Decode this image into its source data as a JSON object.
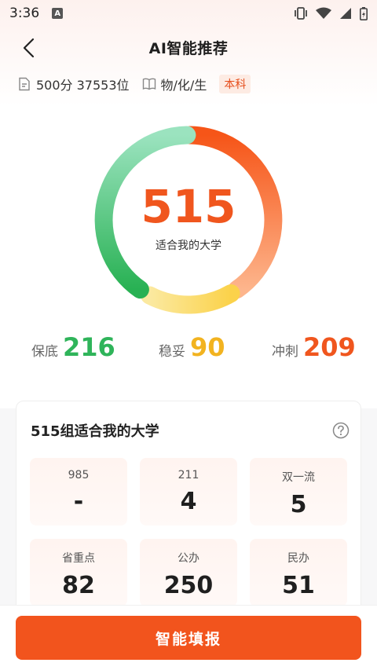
{
  "status_bar": {
    "time": "3:36",
    "app_icon_letter": "A"
  },
  "nav": {
    "title": "AI智能推荐"
  },
  "info": {
    "score_rank": "500分 37553位",
    "subjects": "物/化/生",
    "level": "本科"
  },
  "ring": {
    "total": "515",
    "subtitle": "适合我的大学"
  },
  "stats": [
    {
      "label": "保底",
      "value": "216",
      "color": "#2fb45a"
    },
    {
      "label": "稳妥",
      "value": "90",
      "color": "#f2b320"
    },
    {
      "label": "冲刺",
      "value": "209",
      "color": "#f0561e"
    }
  ],
  "card": {
    "title": "515组适合我的大学",
    "cells": [
      {
        "label": "985",
        "value": "-"
      },
      {
        "label": "211",
        "value": "4"
      },
      {
        "label": "双一流",
        "value": "5"
      },
      {
        "label": "省重点",
        "value": "82"
      },
      {
        "label": "公办",
        "value": "250"
      },
      {
        "label": "民办",
        "value": "51"
      }
    ]
  },
  "submit": {
    "label": "智能填报"
  },
  "colors": {
    "accent": "#f2541d",
    "safe": "#2fb45a",
    "stable": "#f2b320",
    "reach": "#f0561e"
  }
}
